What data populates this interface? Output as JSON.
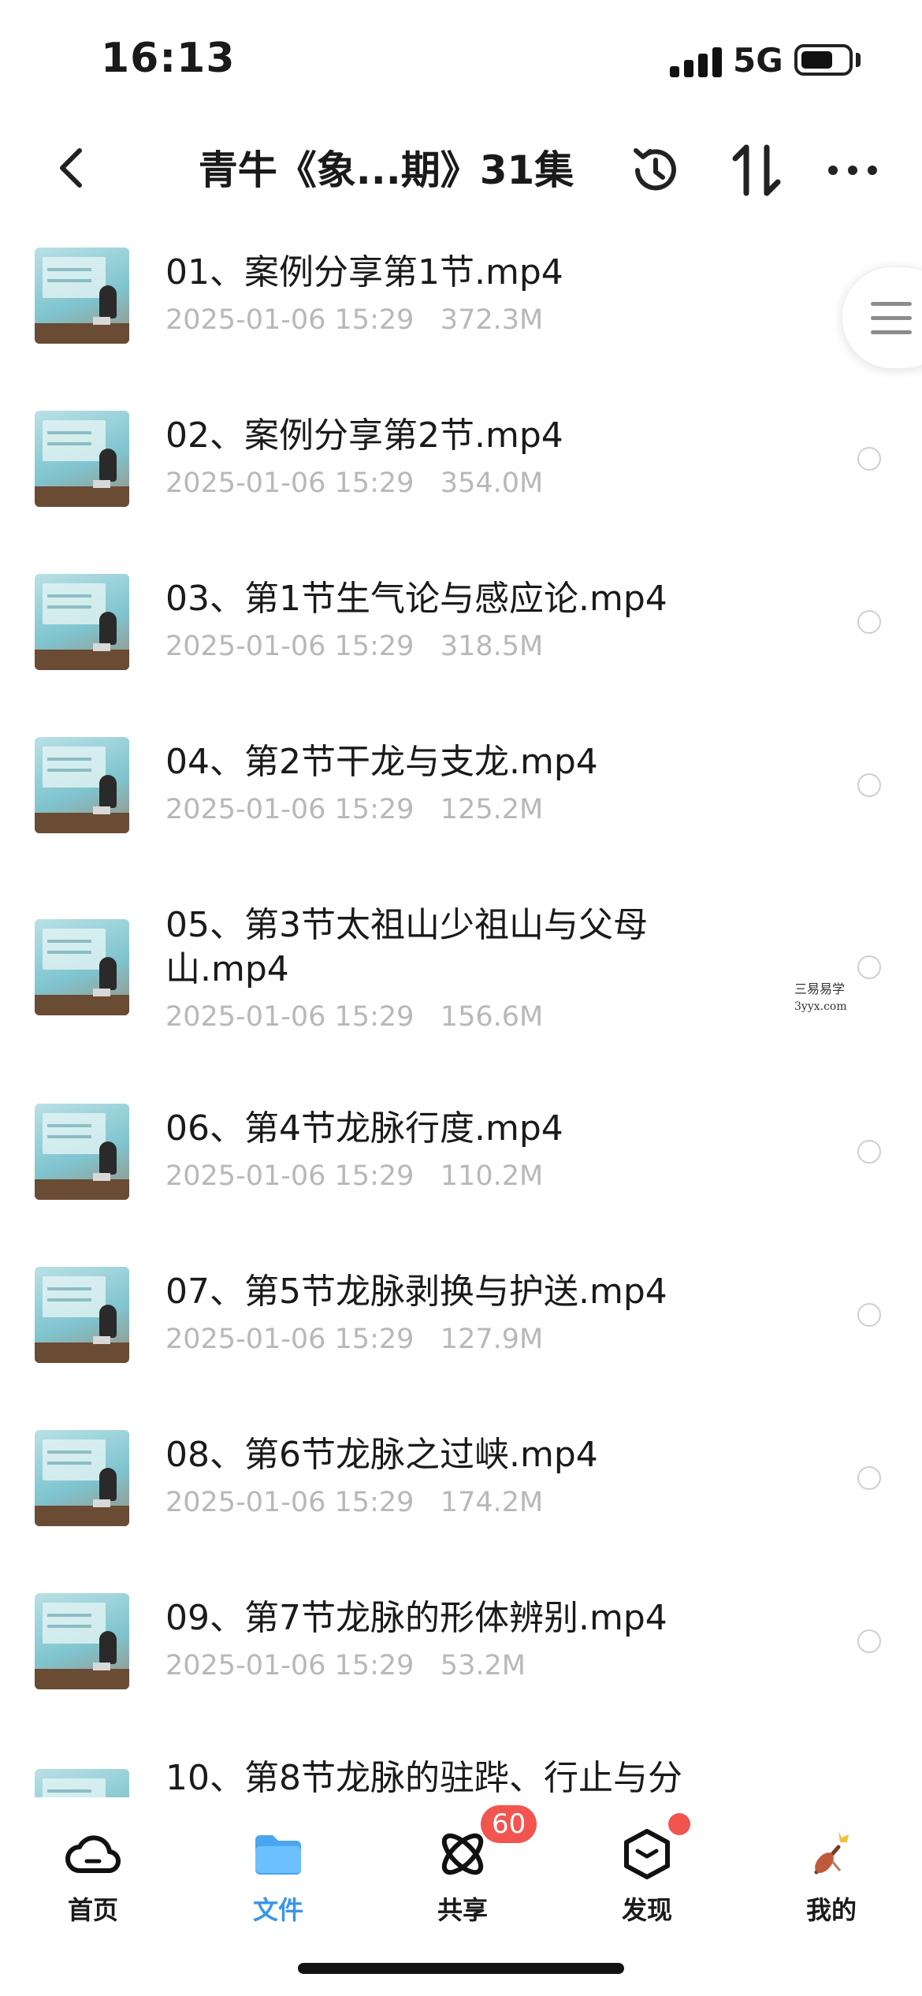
{
  "status_bar": {
    "time": "16:13",
    "network": "5G",
    "battery_level": 0.7
  },
  "header": {
    "title": "青牛《象...期》31集",
    "icons": [
      "back-arrow-icon",
      "history-icon",
      "sort-icon",
      "more-icon"
    ]
  },
  "files": [
    {
      "name": "01、案例分享第1节.mp4",
      "date": "2025-01-06 15:29",
      "size": "372.3M"
    },
    {
      "name": "02、案例分享第2节.mp4",
      "date": "2025-01-06 15:29",
      "size": "354.0M"
    },
    {
      "name": "03、第1节生气论与感应论.mp4",
      "date": "2025-01-06 15:29",
      "size": "318.5M"
    },
    {
      "name": "04、第2节干龙与支龙.mp4",
      "date": "2025-01-06 15:29",
      "size": "125.2M"
    },
    {
      "name": "05、第3节太祖山少祖山与父母山.mp4",
      "date": "2025-01-06 15:29",
      "size": "156.6M"
    },
    {
      "name": "06、第4节龙脉行度.mp4",
      "date": "2025-01-06 15:29",
      "size": "110.2M"
    },
    {
      "name": "07、第5节龙脉剥换与护送.mp4",
      "date": "2025-01-06 15:29",
      "size": "127.9M"
    },
    {
      "name": "08、第6节龙脉之过峡.mp4",
      "date": "2025-01-06 15:29",
      "size": "174.2M"
    },
    {
      "name": "09、第7节龙脉的形体辨别.mp4",
      "date": "2025-01-06 15:29",
      "size": "53.2M"
    },
    {
      "name": "10、第8节龙脉的驻跸、行止与分",
      "date": "",
      "size": ""
    }
  ],
  "watermark": {
    "name": "三易易学",
    "url": "3yyx.com"
  },
  "tabbar": {
    "tabs": [
      {
        "label": "首页",
        "icon": "cloud-icon"
      },
      {
        "label": "文件",
        "icon": "folder-icon"
      },
      {
        "label": "共享",
        "icon": "atom-icon",
        "badge": "60"
      },
      {
        "label": "发现",
        "icon": "hexagon-icon"
      },
      {
        "label": "我的",
        "icon": "avatar-icon"
      }
    ],
    "active": "文件"
  },
  "colors": {
    "accent": "#3a95e8",
    "badge": "#f2544f",
    "meta_text": "#b8b8b8"
  }
}
